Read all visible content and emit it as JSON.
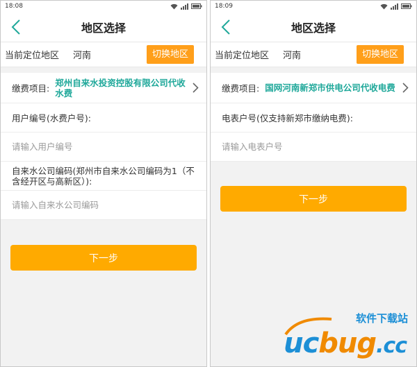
{
  "phones": {
    "left": {
      "status_time": "18:08",
      "title": "地区选择",
      "location_label": "当前定位地区",
      "location_value": "河南",
      "switch_label": "切换地区",
      "fee_label": "缴费项目:",
      "fee_value": "郑州自来水投资控股有限公司代收水费",
      "field1_label": "用户编号(水费户号):",
      "field1_placeholder": "请输入用户编号",
      "field2_label": "自来水公司编码(郑州市自来水公司编码为1（不含经开区与高新区）):",
      "field2_placeholder": "请输入自来水公司编码",
      "next_label": "下一步"
    },
    "right": {
      "status_time": "18:09",
      "title": "地区选择",
      "location_label": "当前定位地区",
      "location_value": "河南",
      "switch_label": "切换地区",
      "fee_label": "缴费项目:",
      "fee_value": "国网河南新郑市供电公司代收电费",
      "field1_label": "电表户号(仅支持新郑市缴纳电费):",
      "field1_placeholder": "请输入电表户号",
      "next_label": "下一步"
    }
  },
  "watermark": {
    "cn_text": "软件下载站",
    "logo_uc": "uc",
    "logo_bug": "bug",
    "logo_cc": ".cc"
  },
  "colors": {
    "accent_orange": "#ffaa00",
    "switch_orange": "#ff9f1a",
    "fee_teal": "#1fa89a",
    "back_teal": "#1fa89a",
    "logo_blue": "#1c8fd6",
    "logo_orange": "#f08a00"
  },
  "icons": [
    "back-arrow-icon",
    "chevron-right-icon",
    "wifi-icon",
    "signal-icon",
    "battery-icon"
  ]
}
